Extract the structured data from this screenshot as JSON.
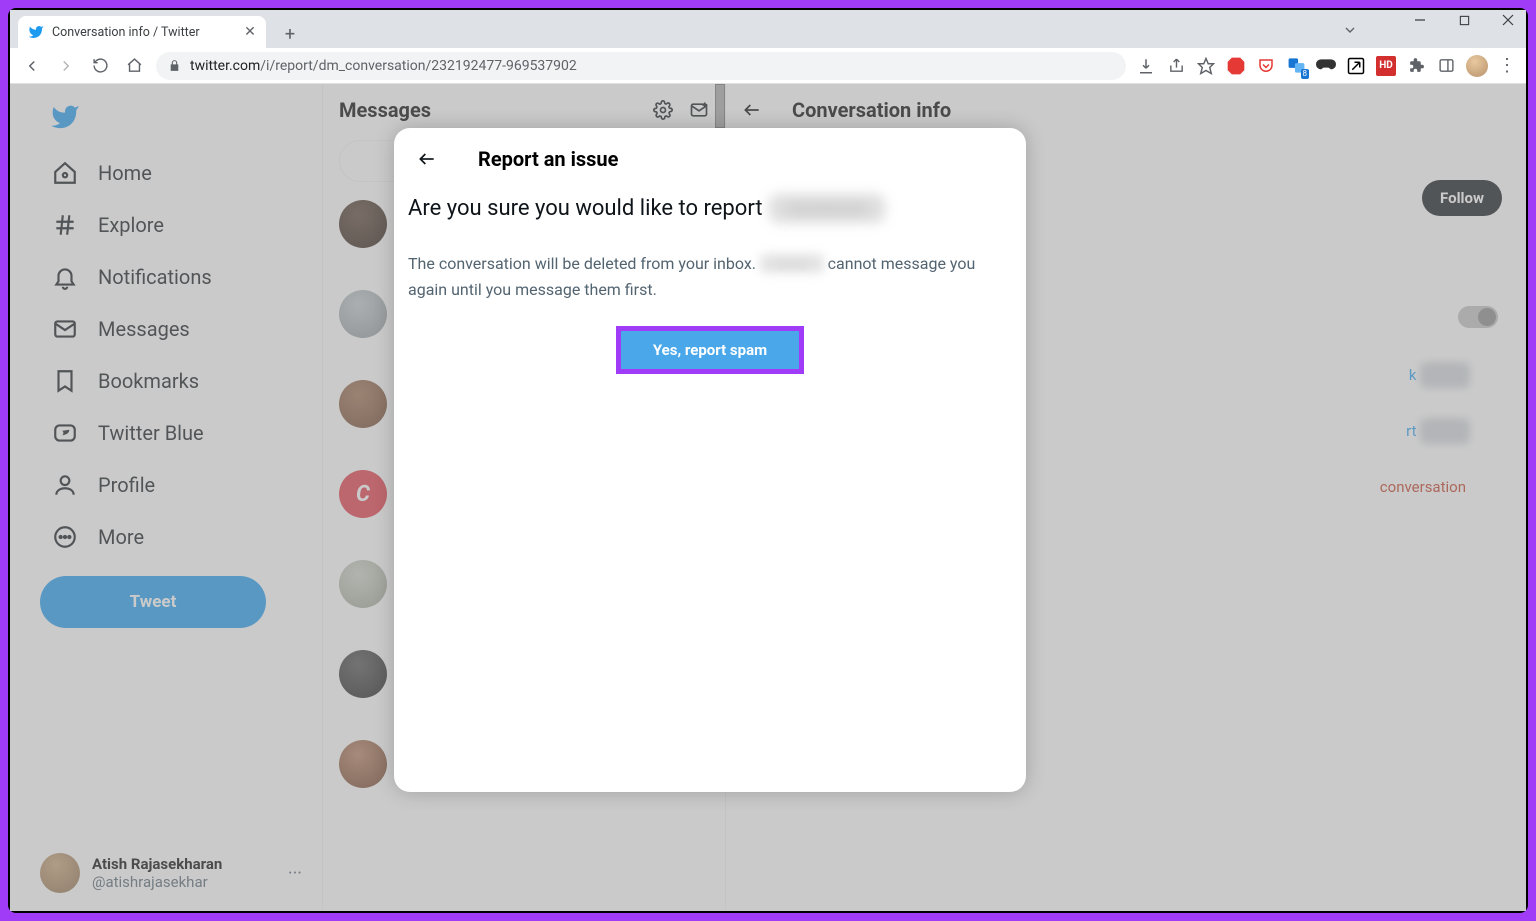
{
  "browser": {
    "tab_title": "Conversation info / Twitter",
    "url_host": "twitter.com",
    "url_path": "/i/report/dm_conversation/232192477-969537902"
  },
  "sidebar": {
    "items": [
      {
        "label": "Home",
        "icon": "home"
      },
      {
        "label": "Explore",
        "icon": "hash"
      },
      {
        "label": "Notifications",
        "icon": "bell"
      },
      {
        "label": "Messages",
        "icon": "mail"
      },
      {
        "label": "Bookmarks",
        "icon": "bookmark"
      },
      {
        "label": "Twitter Blue",
        "icon": "blue"
      },
      {
        "label": "Profile",
        "icon": "user"
      },
      {
        "label": "More",
        "icon": "more"
      }
    ],
    "tweet_label": "Tweet",
    "me_name": "Atish Rajasekharan",
    "me_handle": "@atishrajasekhar"
  },
  "messages": {
    "title": "Messages"
  },
  "info": {
    "title": "Conversation info",
    "follow_label": "Follow",
    "block_suffix": "k",
    "report_suffix": "rt",
    "leave_suffix": "conversation"
  },
  "modal": {
    "title": "Report an issue",
    "question_prefix": "Are you sure you would like to report",
    "desc_part1": "The conversation will be deleted from your inbox.",
    "desc_part2": "cannot message you again until you message them first.",
    "button_label": "Yes, report spam"
  }
}
